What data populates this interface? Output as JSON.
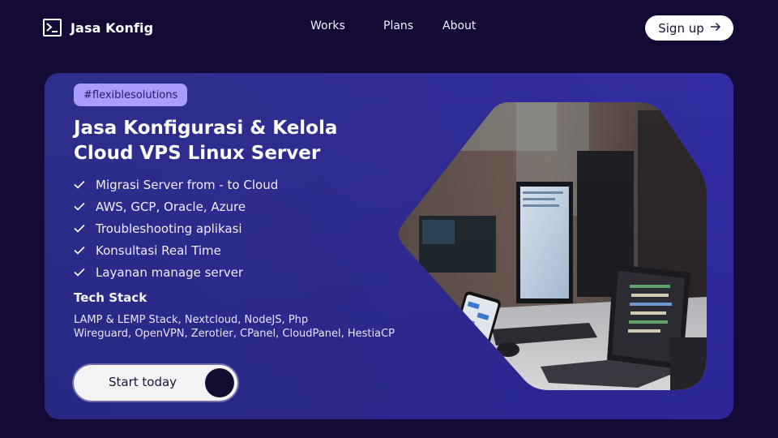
{
  "nav": {
    "brand_icon": "terminal-icon",
    "brand_name": "Jasa Konfig",
    "links": [
      "Works",
      "Plans",
      "About"
    ],
    "signup_label": "Sign up",
    "signup_icon": "arrow-right-icon"
  },
  "hero": {
    "tag": "#flexiblesolutions",
    "headline_line1": "Jasa Konfigurasi & Kelola",
    "headline_line2": "Cloud VPS Linux Server",
    "features": [
      "Migrasi Server from - to Cloud",
      "AWS, GCP, Oracle, Azure",
      "Troubleshooting aplikasi",
      "Konsultasi Real Time",
      "Layanan manage server"
    ],
    "feature_icon": "check-icon",
    "tech_title": "Tech Stack",
    "tech_line1": "LAMP & LEMP Stack, Nextcloud, NodeJS, Php",
    "tech_line2": "Wireguard, OpenVPN, Zerotier, CPanel, CloudPanel, HestiaCP",
    "cta_label": "Start  today",
    "image_subject": "workstation-photo"
  },
  "colors": {
    "background": "#140a35",
    "card": "#2d2990",
    "tag_bg": "#a89bff",
    "button_bg": "#ffffff",
    "button_dot": "#150c33"
  }
}
